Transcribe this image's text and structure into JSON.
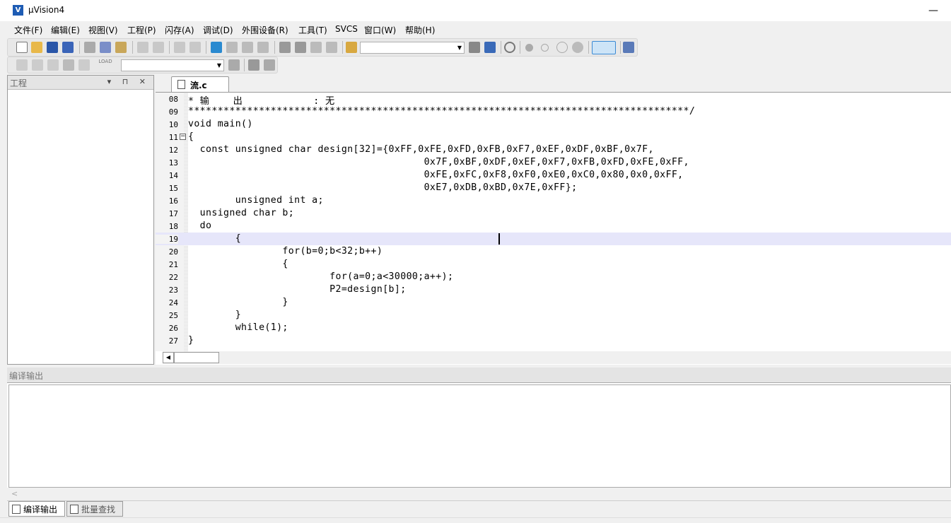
{
  "window": {
    "title": "μVision4",
    "minimize": "—"
  },
  "menu": [
    {
      "label": "文件(F)"
    },
    {
      "label": "编辑(E)"
    },
    {
      "label": "视图(V)"
    },
    {
      "label": "工程(P)"
    },
    {
      "label": "闪存(A)"
    },
    {
      "label": "调试(D)"
    },
    {
      "label": "外围设备(R)"
    },
    {
      "label": "工具(T)"
    },
    {
      "label": "SVCS"
    },
    {
      "label": "窗口(W)"
    },
    {
      "label": "帮助(H)"
    }
  ],
  "toolbar": {
    "icons": [
      "new-file-icon",
      "open-folder-icon",
      "save-icon",
      "save-all-icon",
      "cut-icon",
      "copy-icon",
      "paste-icon",
      "undo-icon",
      "redo-icon",
      "nav-back-icon",
      "nav-forward-icon",
      "bookmark-icon",
      "prev-bookmark-icon",
      "next-bookmark-icon",
      "clear-bookmarks-icon",
      "indent-icon",
      "unindent-icon",
      "comment-icon",
      "uncomment-icon",
      "find-in-files-icon"
    ],
    "find_combo_value": "",
    "load_label": "LOAD",
    "target_combo_value": ""
  },
  "project": {
    "title": "工程",
    "controls": "▾ ⊓ ✕"
  },
  "editor": {
    "tab_label": "流.c",
    "lines": [
      {
        "no": "08",
        "text": "* 输    出            : 无"
      },
      {
        "no": "09",
        "text": "*************************************************************************************/"
      },
      {
        "no": "10",
        "text": "void main()"
      },
      {
        "no": "11",
        "text": "{"
      },
      {
        "no": "12",
        "text": "  const unsigned char design[32]={0xFF,0xFE,0xFD,0xFB,0xF7,0xEF,0xDF,0xBF,0x7F,"
      },
      {
        "no": "13",
        "text": "                                        0x7F,0xBF,0xDF,0xEF,0xF7,0xFB,0xFD,0xFE,0xFF,"
      },
      {
        "no": "14",
        "text": "                                        0xFE,0xFC,0xF8,0xF0,0xE0,0xC0,0x80,0x0,0xFF,"
      },
      {
        "no": "15",
        "text": "                                        0xE7,0xDB,0xBD,0x7E,0xFF};"
      },
      {
        "no": "16",
        "text": "        unsigned int a;"
      },
      {
        "no": "17",
        "text": "  unsigned char b;"
      },
      {
        "no": "18",
        "text": "  do"
      },
      {
        "no": "19",
        "text": "        {"
      },
      {
        "no": "20",
        "text": "                for(b=0;b<32;b++)"
      },
      {
        "no": "21",
        "text": "                {"
      },
      {
        "no": "22",
        "text": "                        for(a=0;a<30000;a++);"
      },
      {
        "no": "23",
        "text": "                        P2=design[b];"
      },
      {
        "no": "24",
        "text": "                }"
      },
      {
        "no": "25",
        "text": "        }"
      },
      {
        "no": "26",
        "text": "        while(1);"
      },
      {
        "no": "27",
        "text": "}"
      }
    ],
    "current_line_index": 11
  },
  "output": {
    "title": "编译输出",
    "content": "",
    "scroll_left": "<"
  },
  "bottom_tabs": [
    {
      "label": "编译输出"
    },
    {
      "label": "批量查找"
    }
  ]
}
